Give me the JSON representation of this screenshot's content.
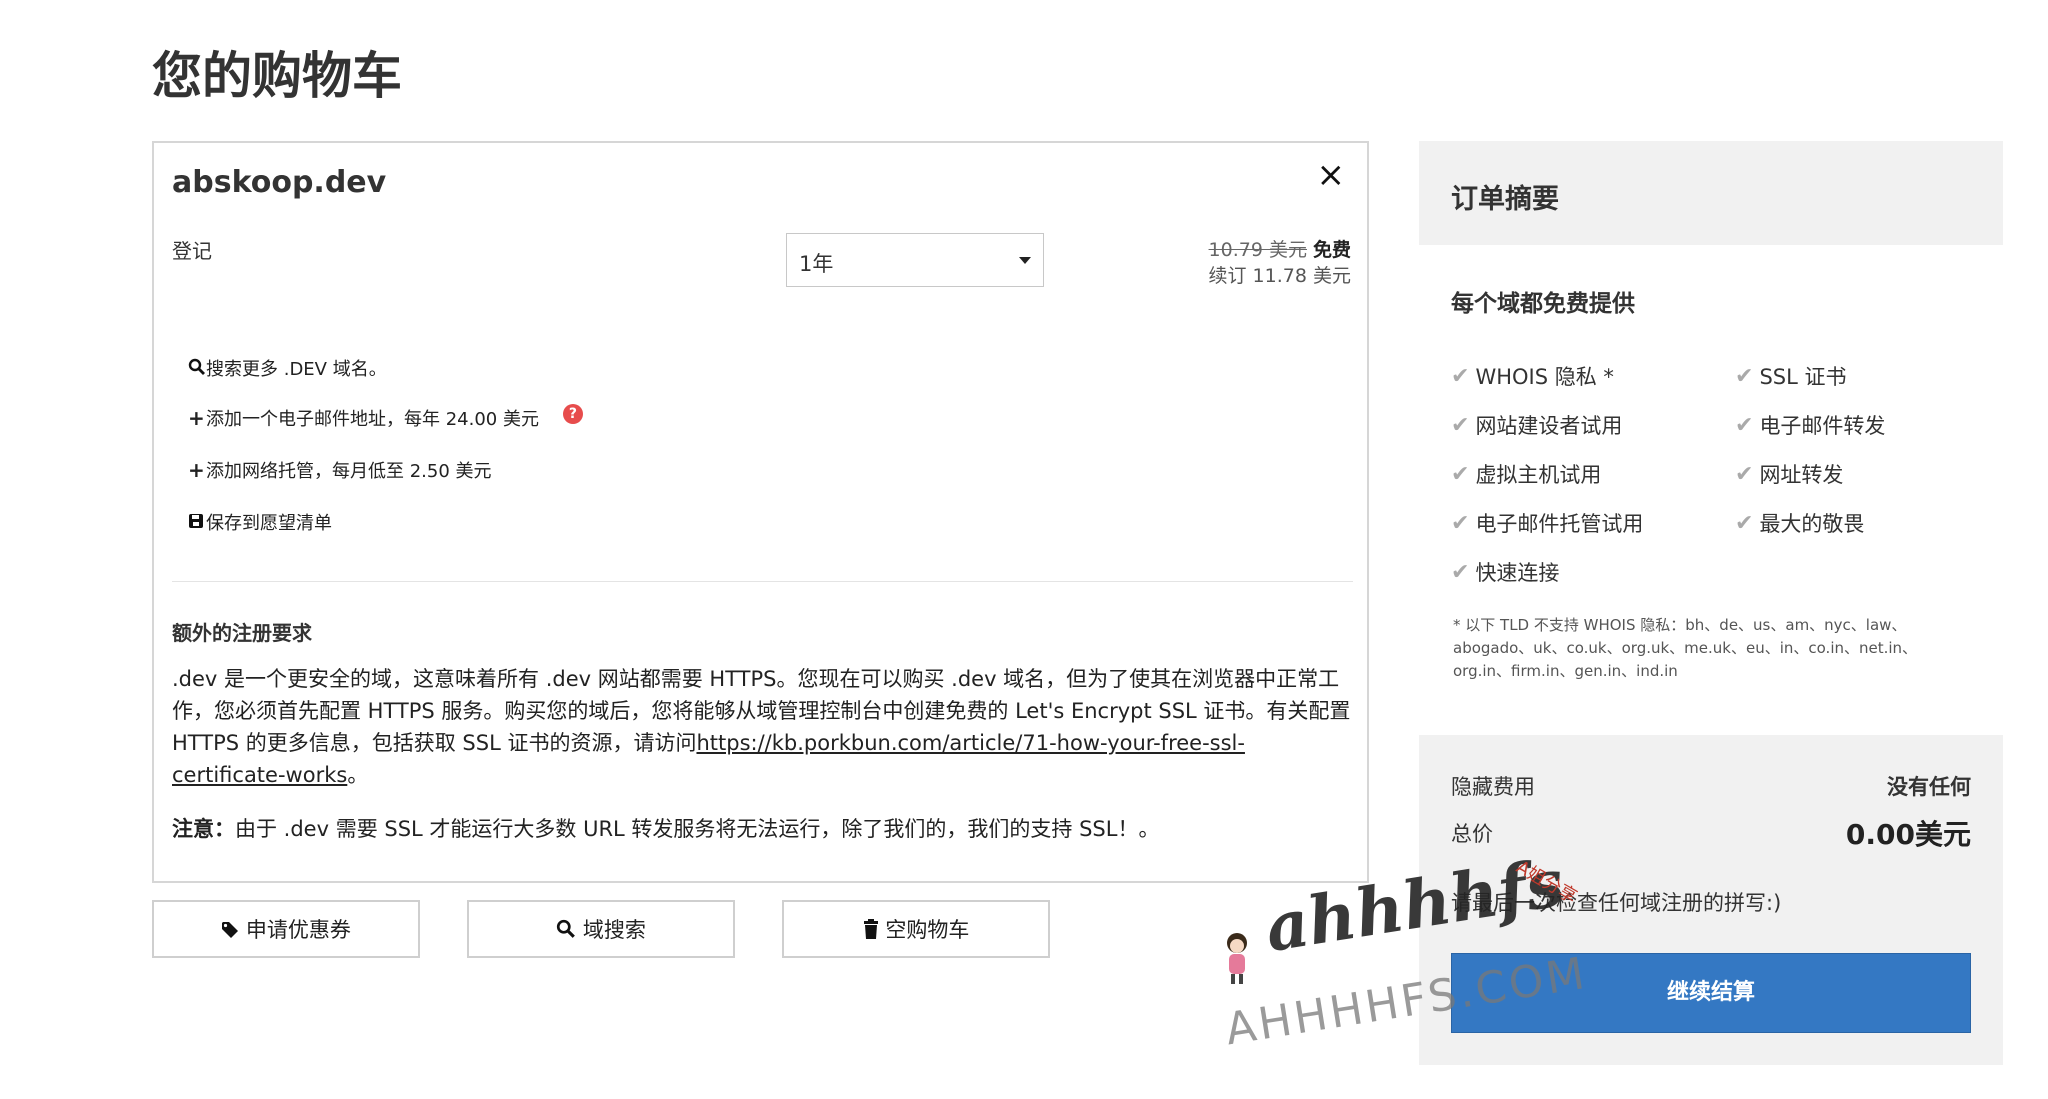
{
  "page_title": "您的购物车",
  "cart": {
    "domain": "abskoop.dev",
    "close_icon": "×",
    "registration_label": "登记",
    "term_value": "1年",
    "old_price": "10.79 美元",
    "price_free": "免费",
    "renewal": "续订 11.78 美元",
    "options": {
      "search_more": "搜索更多 .DEV 域名。",
      "add_email": "添加一个电子邮件地址，每年 24.00 美元",
      "add_hosting": "添加网络托管，每月低至 2.50 美元",
      "save_wishlist": "保存到愿望清单",
      "help_icon": "?"
    },
    "requirements_title": "额外的注册要求",
    "requirements_text": ".dev 是一个更安全的域，这意味着所有 .dev 网站都需要 HTTPS。您现在可以购买 .dev 域名，但为了使其在浏览器中正常工作，您必须首先配置 HTTPS 服务。购买您的域后，您将能够从域管理控制台中创建免费的 Let's Encrypt SSL 证书。有关配置 HTTPS 的更多信息，包括获取 SSL 证书的资源，请访问",
    "requirements_link": "https://kb.porkbun.com/article/71-how-your-free-ssl-certificate-works",
    "requirements_end": "。",
    "note_label": "注意：",
    "note_text": "由于 .dev 需要 SSL 才能运行大多数 URL 转发服务将无法运行，除了我们的，我们的支持 SSL！。"
  },
  "buttons": {
    "coupon": "申请优惠券",
    "domain_search": "域搜索",
    "empty_cart": "空购物车"
  },
  "summary": {
    "title": "订单摘要",
    "perks_title": "每个域都免费提供",
    "perks": [
      "WHOIS 隐私 *",
      "SSL 证书",
      "网站建设者试用",
      "电子邮件转发",
      "虚拟主机试用",
      "网址转发",
      "电子邮件托管试用",
      "最大的敬畏",
      "快速连接"
    ],
    "footnote": "* 以下 TLD 不支持 WHOIS 隐私：bh、de、us、am、nyc、law、abogado、uk、co.uk、org.uk、me.uk、eu、in、co.in、net.in、org.in、firm.in、gen.in、ind.in",
    "hidden_fees_label": "隐藏费用",
    "hidden_fees_value": "没有任何",
    "total_label": "总价",
    "total_value": "0.00美元",
    "spell_check": "请最后一次检查任何域注册的拼写:)",
    "checkout": "继续结算"
  },
  "watermark": {
    "script": "ahhhhfs",
    "url": "AHHHHFS.COM",
    "small": "A姐分享"
  }
}
